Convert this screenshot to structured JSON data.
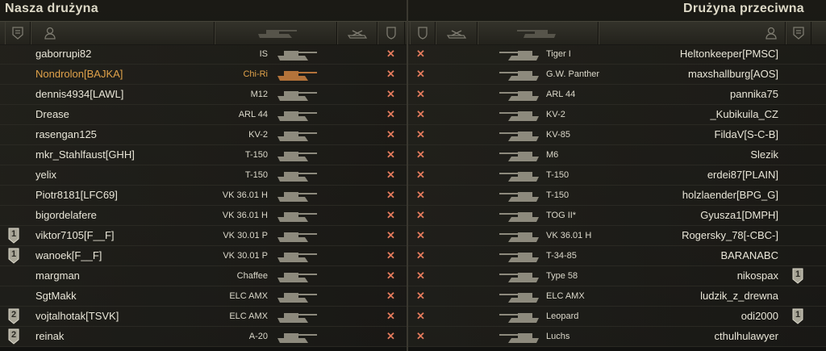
{
  "left_team": {
    "title": "Nasza drużyna",
    "header_icons": [
      "platoon-icon",
      "player-icon",
      "tank-icon",
      "frags-icon",
      "status-icon"
    ],
    "rows": [
      {
        "player": "gaborrupi82",
        "vehicle": "IS",
        "status": "✕",
        "platoon": "",
        "highlight": false
      },
      {
        "player": "Nondrolon[BAJKA]",
        "vehicle": "Chi-Ri",
        "status": "✕",
        "platoon": "",
        "highlight": true
      },
      {
        "player": "dennis4934[LAWL]",
        "vehicle": "M12",
        "status": "✕",
        "platoon": "",
        "highlight": false
      },
      {
        "player": "Drease",
        "vehicle": "ARL 44",
        "status": "✕",
        "platoon": "",
        "highlight": false
      },
      {
        "player": "rasengan125",
        "vehicle": "KV-2",
        "status": "✕",
        "platoon": "",
        "highlight": false
      },
      {
        "player": "mkr_Stahlfaust[GHH]",
        "vehicle": "T-150",
        "status": "✕",
        "platoon": "",
        "highlight": false
      },
      {
        "player": "yelix",
        "vehicle": "T-150",
        "status": "✕",
        "platoon": "",
        "highlight": false
      },
      {
        "player": "Piotr8181[LFC69]",
        "vehicle": "VK 36.01 H",
        "status": "✕",
        "platoon": "",
        "highlight": false
      },
      {
        "player": "bigordelafere",
        "vehicle": "VK 36.01 H",
        "status": "✕",
        "platoon": "",
        "highlight": false
      },
      {
        "player": "viktor7105[F__F]",
        "vehicle": "VK 30.01 P",
        "status": "✕",
        "platoon": "1",
        "highlight": false
      },
      {
        "player": "wanoek[F__F]",
        "vehicle": "VK 30.01 P",
        "status": "✕",
        "platoon": "1",
        "highlight": false
      },
      {
        "player": "margman",
        "vehicle": "Chaffee",
        "status": "✕",
        "platoon": "",
        "highlight": false
      },
      {
        "player": "SgtMakk",
        "vehicle": "ELC AMX",
        "status": "✕",
        "platoon": "",
        "highlight": false
      },
      {
        "player": "vojtalhotak[TSVK]",
        "vehicle": "ELC AMX",
        "status": "✕",
        "platoon": "2",
        "highlight": false
      },
      {
        "player": "reinak",
        "vehicle": "A-20",
        "status": "✕",
        "platoon": "2",
        "highlight": false
      }
    ]
  },
  "right_team": {
    "title": "Drużyna przeciwna",
    "header_icons": [
      "status-icon",
      "frags-icon",
      "tank-icon",
      "player-icon",
      "platoon-icon"
    ],
    "rows": [
      {
        "player": "Heltonkeeper[PMSC]",
        "vehicle": "Tiger I",
        "status": "✕",
        "platoon": ""
      },
      {
        "player": "maxshallburg[AOS]",
        "vehicle": "G.W. Panther",
        "status": "✕",
        "platoon": ""
      },
      {
        "player": "pannika75",
        "vehicle": "ARL 44",
        "status": "✕",
        "platoon": ""
      },
      {
        "player": "_Kubikuila_CZ",
        "vehicle": "KV-2",
        "status": "✕",
        "platoon": ""
      },
      {
        "player": "FildaV[S-C-B]",
        "vehicle": "KV-85",
        "status": "✕",
        "platoon": ""
      },
      {
        "player": "Slezik",
        "vehicle": "M6",
        "status": "✕",
        "platoon": ""
      },
      {
        "player": "erdei87[PLAIN]",
        "vehicle": "T-150",
        "status": "✕",
        "platoon": ""
      },
      {
        "player": "holzlaender[BPG_G]",
        "vehicle": "T-150",
        "status": "✕",
        "platoon": ""
      },
      {
        "player": "Gyusza1[DMPH]",
        "vehicle": "TOG II*",
        "status": "✕",
        "platoon": ""
      },
      {
        "player": "Rogersky_78[-CBC-]",
        "vehicle": "VK 36.01 H",
        "status": "✕",
        "platoon": ""
      },
      {
        "player": "BARANABC",
        "vehicle": "T-34-85",
        "status": "✕",
        "platoon": ""
      },
      {
        "player": "nikospax",
        "vehicle": "Type 58",
        "status": "✕",
        "platoon": "1"
      },
      {
        "player": "ludzik_z_drewna",
        "vehicle": "ELC AMX",
        "status": "✕",
        "platoon": ""
      },
      {
        "player": "odi2000",
        "vehicle": "Leopard",
        "status": "✕",
        "platoon": "1"
      },
      {
        "player": "cthulhulawyer",
        "vehicle": "Luchs",
        "status": "✕",
        "platoon": ""
      }
    ]
  },
  "colors": {
    "highlight": "#e0a24a",
    "text": "#e9e6d8",
    "status_x": "#e27a5c",
    "header_bg": "#2c2b24"
  }
}
